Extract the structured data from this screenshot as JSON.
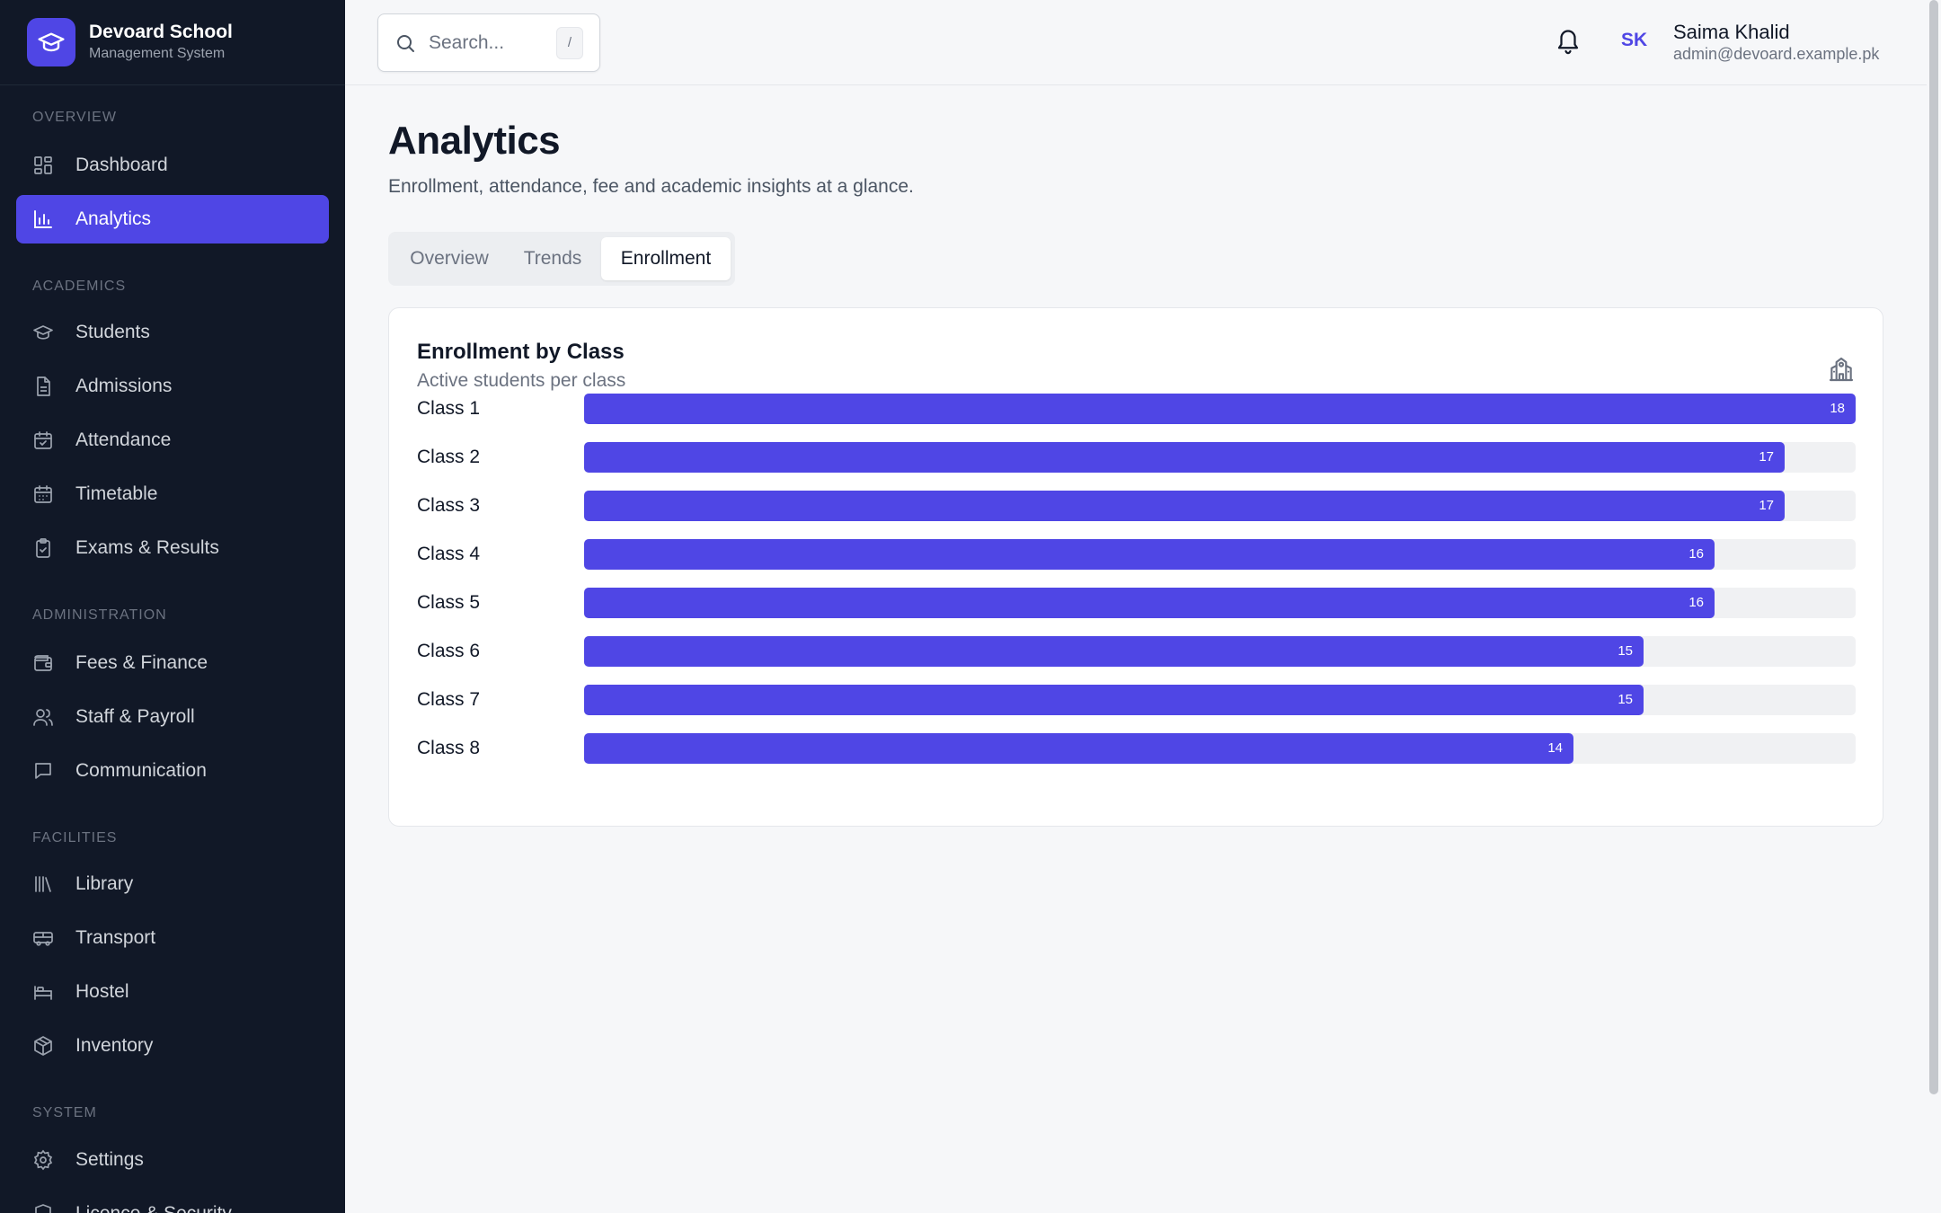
{
  "brand": {
    "name": "Devoard School",
    "subtitle": "Management System"
  },
  "sidebar": {
    "sections": [
      {
        "title": "OVERVIEW",
        "items": [
          {
            "label": "Dashboard",
            "icon": "dashboard-icon"
          },
          {
            "label": "Analytics",
            "icon": "bar-chart-icon",
            "active": true
          }
        ]
      },
      {
        "title": "ACADEMICS",
        "items": [
          {
            "label": "Students",
            "icon": "graduation-cap-icon"
          },
          {
            "label": "Admissions",
            "icon": "document-icon"
          },
          {
            "label": "Attendance",
            "icon": "calendar-check-icon"
          },
          {
            "label": "Timetable",
            "icon": "calendar-icon"
          },
          {
            "label": "Exams & Results",
            "icon": "clipboard-check-icon"
          }
        ]
      },
      {
        "title": "ADMINISTRATION",
        "items": [
          {
            "label": "Fees & Finance",
            "icon": "wallet-icon"
          },
          {
            "label": "Staff & Payroll",
            "icon": "users-icon"
          },
          {
            "label": "Communication",
            "icon": "message-icon"
          }
        ]
      },
      {
        "title": "FACILITIES",
        "items": [
          {
            "label": "Library",
            "icon": "library-icon"
          },
          {
            "label": "Transport",
            "icon": "bus-icon"
          },
          {
            "label": "Hostel",
            "icon": "bed-icon"
          },
          {
            "label": "Inventory",
            "icon": "package-icon"
          }
        ]
      },
      {
        "title": "SYSTEM",
        "items": [
          {
            "label": "Settings",
            "icon": "gear-icon"
          },
          {
            "label": "Licence & Security",
            "icon": "shield-icon"
          }
        ]
      }
    ]
  },
  "header": {
    "search_placeholder": "Search...",
    "search_shortcut": "/",
    "user": {
      "initials": "SK",
      "name": "Saima Khalid",
      "email": "admin@devoard.example.pk"
    }
  },
  "page": {
    "title": "Analytics",
    "subtitle": "Enrollment, attendance, fee and academic insights at a glance."
  },
  "tabs": [
    {
      "label": "Overview",
      "active": false
    },
    {
      "label": "Trends",
      "active": false
    },
    {
      "label": "Enrollment",
      "active": true
    }
  ],
  "card": {
    "title": "Enrollment by Class",
    "subtitle": "Active students per class",
    "icon": "school-building-icon"
  },
  "colors": {
    "accent": "#4f46e5",
    "sidebar_bg": "#111827",
    "track": "#f0f1f3"
  },
  "chart_data": {
    "type": "bar",
    "orientation": "horizontal",
    "categories": [
      "Class 1",
      "Class 2",
      "Class 3",
      "Class 4",
      "Class 5",
      "Class 6",
      "Class 7",
      "Class 8"
    ],
    "values": [
      18,
      17,
      17,
      16,
      16,
      15,
      15,
      14
    ],
    "xlim": [
      0,
      18
    ]
  }
}
